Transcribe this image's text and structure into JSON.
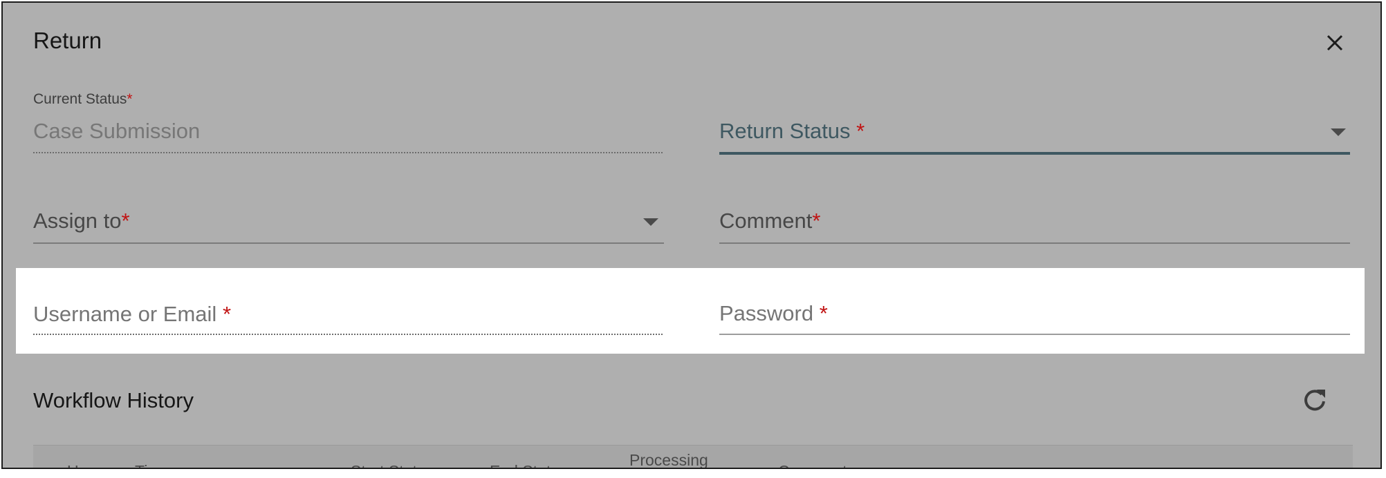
{
  "dialog": {
    "title": "Return",
    "close_icon": "close-icon"
  },
  "fields": {
    "current_status": {
      "label": "Current Status",
      "required_mark": "*",
      "value": "Case Submission"
    },
    "return_status": {
      "label": "Return Status",
      "required_mark": "*"
    },
    "assign_to": {
      "label": "Assign to",
      "required_mark": "*"
    },
    "comment": {
      "label": "Comment",
      "required_mark": "*"
    },
    "username": {
      "label": "Username or Email",
      "required_mark": "*"
    },
    "password": {
      "label": "Password",
      "required_mark": "*"
    }
  },
  "workflow_history": {
    "title": "Workflow History",
    "refresh_icon": "refresh-icon",
    "columns": [
      "User",
      "Time",
      "Start Status",
      "End Status",
      "Processing",
      "Comment"
    ]
  },
  "colors": {
    "overlay": "#afafaf",
    "required": "#c11313",
    "focus_underline": "#3e5861"
  }
}
